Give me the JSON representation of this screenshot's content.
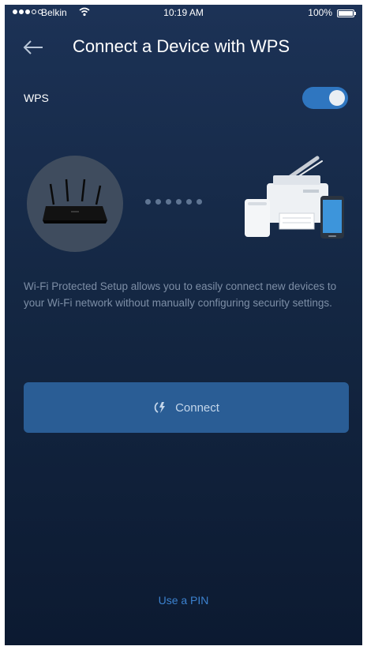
{
  "status_bar": {
    "carrier": "Belkin",
    "time": "10:19 AM",
    "battery": "100%"
  },
  "header": {
    "title": "Connect a Device with WPS"
  },
  "wps": {
    "label": "WPS",
    "enabled": true,
    "toggle_color": "#2f76c0"
  },
  "description": "Wi-Fi Protected Setup allows you to easily connect new devices to your Wi-Fi network without manually configuring security settings.",
  "connect_button": {
    "label": "Connect",
    "color": "#2a5d95"
  },
  "use_pin_link": "Use a PIN",
  "icons": {
    "back": "back-arrow-icon",
    "connect": "wps-icon",
    "router": "router-icon",
    "devices": "devices-icon"
  }
}
